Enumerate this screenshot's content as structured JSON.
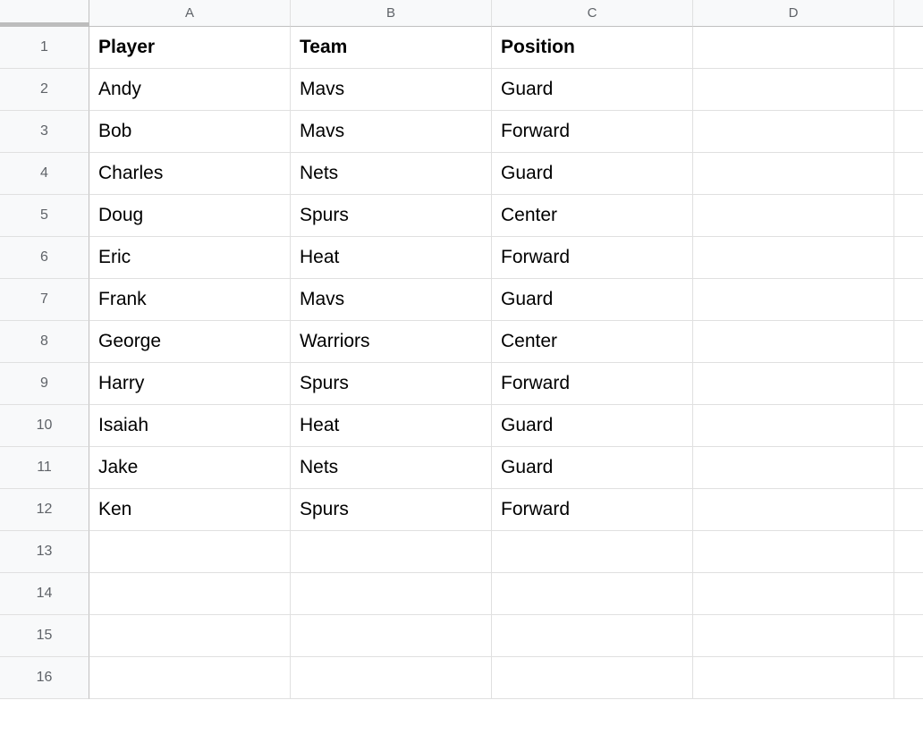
{
  "columns": [
    "A",
    "B",
    "C",
    "D"
  ],
  "rowHeaders": [
    "1",
    "2",
    "3",
    "4",
    "5",
    "6",
    "7",
    "8",
    "9",
    "10",
    "11",
    "12",
    "13",
    "14",
    "15",
    "16"
  ],
  "headerRow": [
    "Player",
    "Team",
    "Position",
    ""
  ],
  "dataRows": [
    [
      "Andy",
      "Mavs",
      "Guard",
      ""
    ],
    [
      "Bob",
      "Mavs",
      "Forward",
      ""
    ],
    [
      "Charles",
      "Nets",
      "Guard",
      ""
    ],
    [
      "Doug",
      "Spurs",
      "Center",
      ""
    ],
    [
      "Eric",
      "Heat",
      "Forward",
      ""
    ],
    [
      "Frank",
      "Mavs",
      "Guard",
      ""
    ],
    [
      "George",
      "Warriors",
      "Center",
      ""
    ],
    [
      "Harry",
      "Spurs",
      "Forward",
      ""
    ],
    [
      "Isaiah",
      "Heat",
      "Guard",
      ""
    ],
    [
      "Jake",
      "Nets",
      "Guard",
      ""
    ],
    [
      "Ken",
      "Spurs",
      "Forward",
      ""
    ],
    [
      "",
      "",
      "",
      ""
    ],
    [
      "",
      "",
      "",
      ""
    ],
    [
      "",
      "",
      "",
      ""
    ],
    [
      "",
      "",
      "",
      ""
    ]
  ]
}
